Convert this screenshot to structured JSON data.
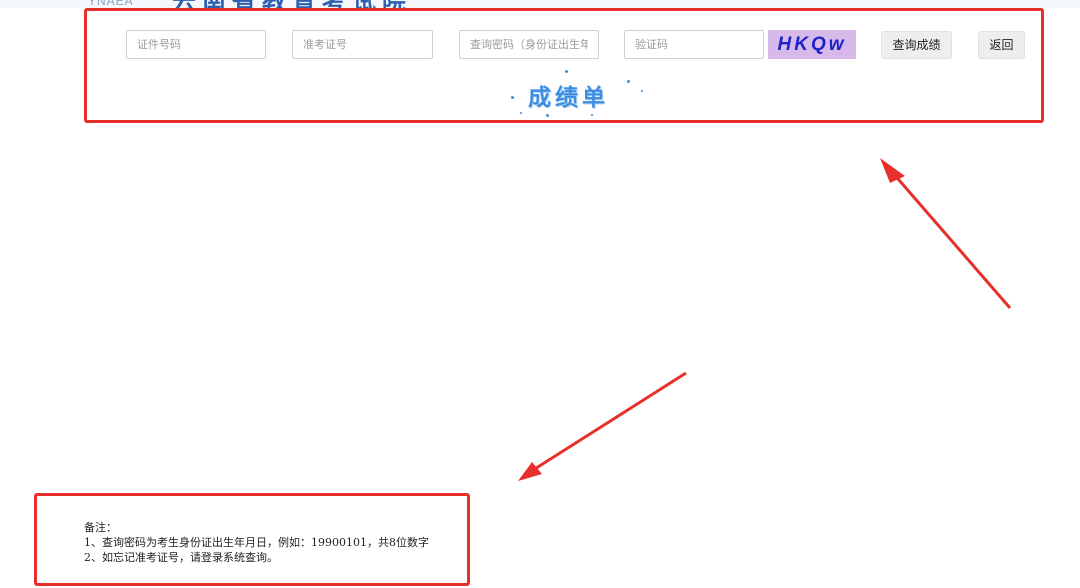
{
  "header": {
    "logo_text": "YNAEA",
    "site_title": "云南省教育考试院"
  },
  "query_form": {
    "id_number_placeholder": "证件号码",
    "exam_number_placeholder": "准考证号",
    "password_placeholder": "查询密码（身份证出生年月日）",
    "captcha_placeholder": "验证码",
    "captcha_text": "HKQw",
    "query_button_label": "查询成绩",
    "back_button_label": "返回"
  },
  "score_heading": "成绩单",
  "notes": {
    "title": "备注：",
    "line1": "1、查询密码为考生身份证出生年月日，例如：19900101，共8位数字",
    "line2": "2、如忘记准考证号，请登录系统查询。"
  },
  "colors": {
    "annotation_red": "#e8302b",
    "captcha_bg": "#d6b9e8",
    "captcha_text": "#1c23c9",
    "heading_blue": "#3d8ee0"
  }
}
